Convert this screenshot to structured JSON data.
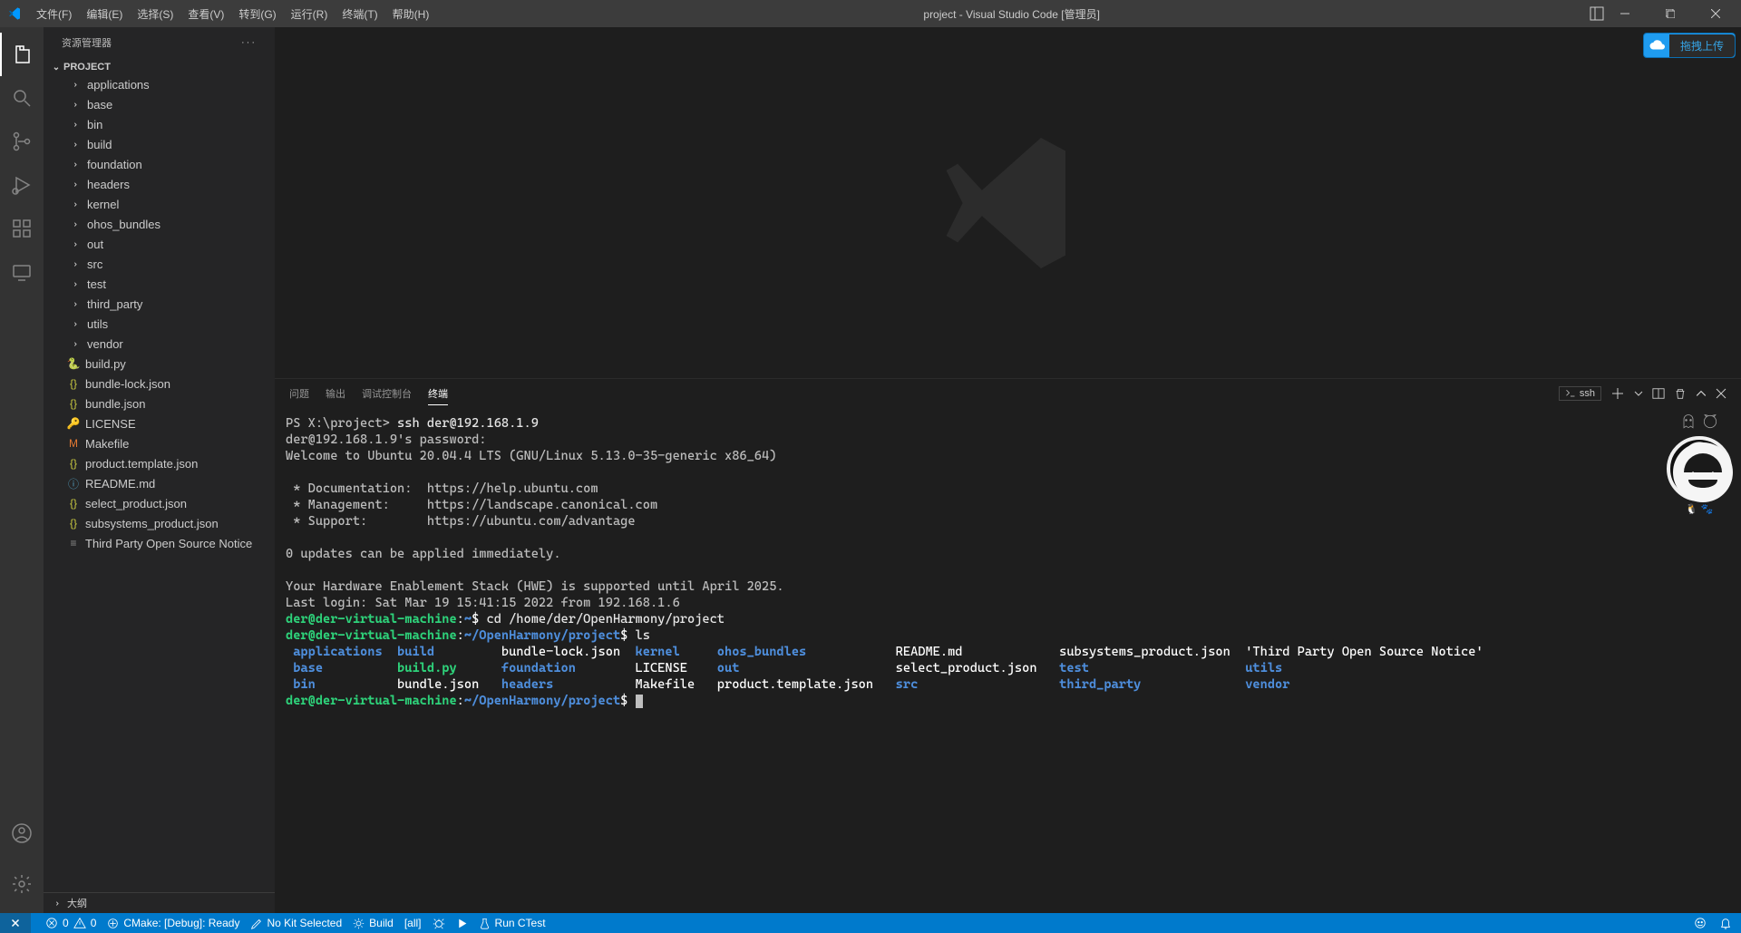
{
  "window": {
    "title": "project - Visual Studio Code [管理员]"
  },
  "menu": [
    {
      "label": "文件(F)"
    },
    {
      "label": "编辑(E)"
    },
    {
      "label": "选择(S)"
    },
    {
      "label": "查看(V)"
    },
    {
      "label": "转到(G)"
    },
    {
      "label": "运行(R)"
    },
    {
      "label": "终端(T)"
    },
    {
      "label": "帮助(H)"
    }
  ],
  "upload_button": "拖拽上传",
  "explorer": {
    "title": "资源管理器",
    "project_label": "PROJECT",
    "outline_label": "大纲",
    "folders": [
      "applications",
      "base",
      "bin",
      "build",
      "foundation",
      "headers",
      "kernel",
      "ohos_bundles",
      "out",
      "src",
      "test",
      "third_party",
      "utils",
      "vendor"
    ],
    "files": [
      {
        "name": "build.py",
        "color": "#3776ab",
        "glyph": "🐍"
      },
      {
        "name": "bundle-lock.json",
        "color": "#cbcb41",
        "glyph": "{}"
      },
      {
        "name": "bundle.json",
        "color": "#cbcb41",
        "glyph": "{}"
      },
      {
        "name": "LICENSE",
        "color": "#d4b73a",
        "glyph": "🔑"
      },
      {
        "name": "Makefile",
        "color": "#e37933",
        "glyph": "M"
      },
      {
        "name": "product.template.json",
        "color": "#cbcb41",
        "glyph": "{}"
      },
      {
        "name": "README.md",
        "color": "#519aba",
        "glyph": "ⓘ"
      },
      {
        "name": "select_product.json",
        "color": "#cbcb41",
        "glyph": "{}"
      },
      {
        "name": "subsystems_product.json",
        "color": "#cbcb41",
        "glyph": "{}"
      },
      {
        "name": "Third Party Open Source Notice",
        "color": "#8a8a8a",
        "glyph": "≡"
      }
    ]
  },
  "panel": {
    "tabs": [
      "问题",
      "输出",
      "调试控制台",
      "终端"
    ],
    "active_tab": 3,
    "terminal_dropdown": "ssh"
  },
  "terminal_lines": {
    "ps_prefix": "PS X:\\project> ",
    "ssh_cmd": "ssh der@192.168.1.9",
    "pw_prompt": "der@192.168.1.9's password:",
    "welcome": "Welcome to Ubuntu 20.04.4 LTS (GNU/Linux 5.13.0-35-generic x86_64)",
    "doc": " * Documentation:  https://help.ubuntu.com",
    "mgmt": " * Management:     https://landscape.canonical.com",
    "sup": " * Support:        https://ubuntu.com/advantage",
    "updates": "0 updates can be applied immediately.",
    "hwe": "Your Hardware Enablement Stack (HWE) is supported until April 2025.",
    "lastlogin": "Last login: Sat Mar 19 15:41:15 2022 from 192.168.1.6",
    "p1_user": "der@der-virtual-machine",
    "p1_path": "~",
    "p1_cmd": "cd /home/der/OpenHarmony/project",
    "p2_path": "~/OpenHarmony/project",
    "p2_cmd": "ls",
    "ls": {
      "c0": [
        "applications",
        "base",
        "bin"
      ],
      "c1": [
        "build",
        "build.py",
        "bundle.json"
      ],
      "c2": [
        "bundle-lock.json",
        "foundation",
        "headers"
      ],
      "c3": [
        "kernel",
        "LICENSE",
        "Makefile"
      ],
      "c4": [
        "ohos_bundles",
        "out",
        "product.template.json"
      ],
      "c5": [
        "README.md",
        "select_product.json",
        "src"
      ],
      "c6": [
        "subsystems_product.json",
        "test",
        "third_party"
      ],
      "c7": [
        "'Third Party Open Source Notice'",
        "utils",
        "vendor"
      ]
    }
  },
  "statusbar": {
    "errors": "0",
    "warnings": "0",
    "cmake": "CMake: [Debug]: Ready",
    "nokit": "No Kit Selected",
    "build": "Build",
    "all": "[all]",
    "ctest": "Run CTest"
  }
}
